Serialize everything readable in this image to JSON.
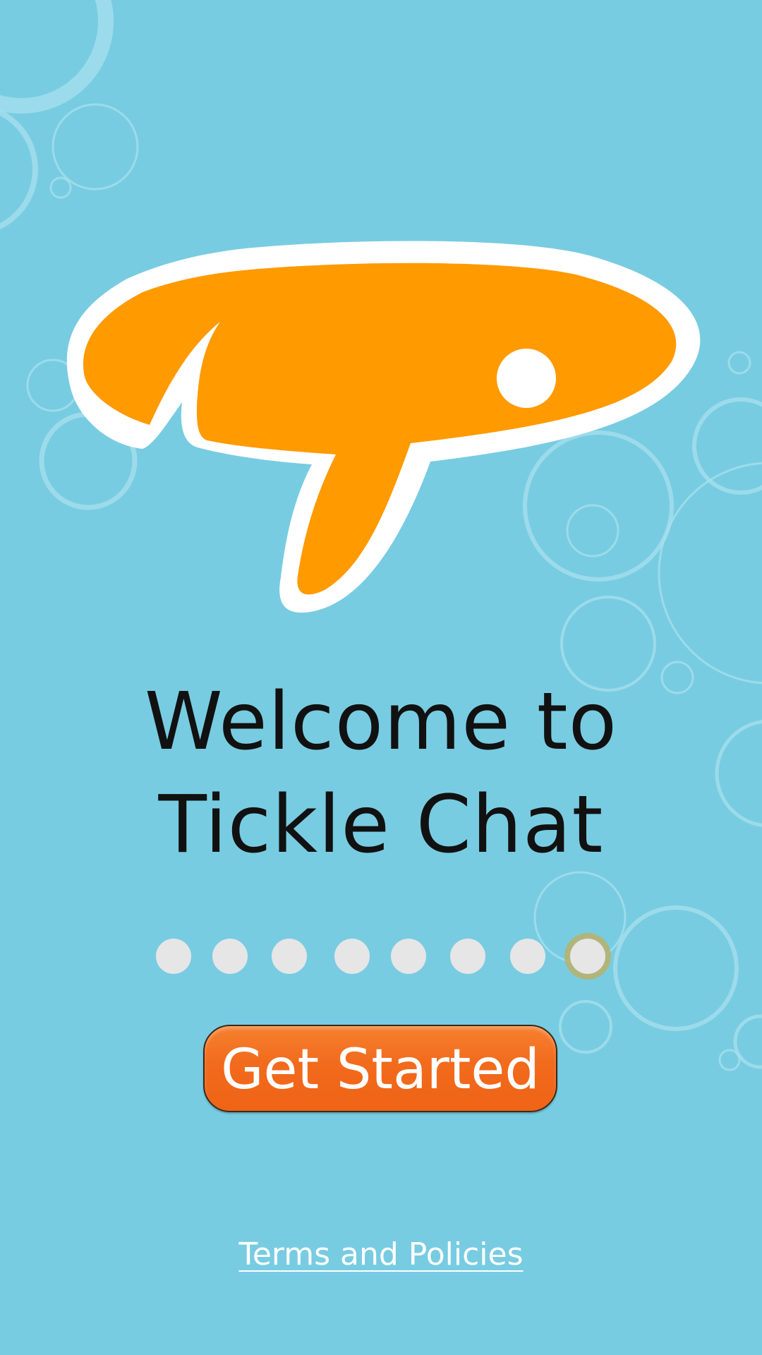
{
  "welcome": {
    "line1": "Welcome to",
    "line2": "Tickle Chat"
  },
  "pager": {
    "total_pages": 8,
    "active_page": 8
  },
  "actions": {
    "get_started_label": "Get Started",
    "terms_label": "Terms and Policies"
  },
  "colors": {
    "background": "#78cce1",
    "logo_orange": "#ff9a00",
    "button_orange": "#f26a1c",
    "dot": "#e6e6e6",
    "active_ring": "#bab068",
    "text_dark": "#111111",
    "text_light": "#ffffff"
  },
  "icons": {
    "logo": "tickle-chat-bubble-icon"
  }
}
